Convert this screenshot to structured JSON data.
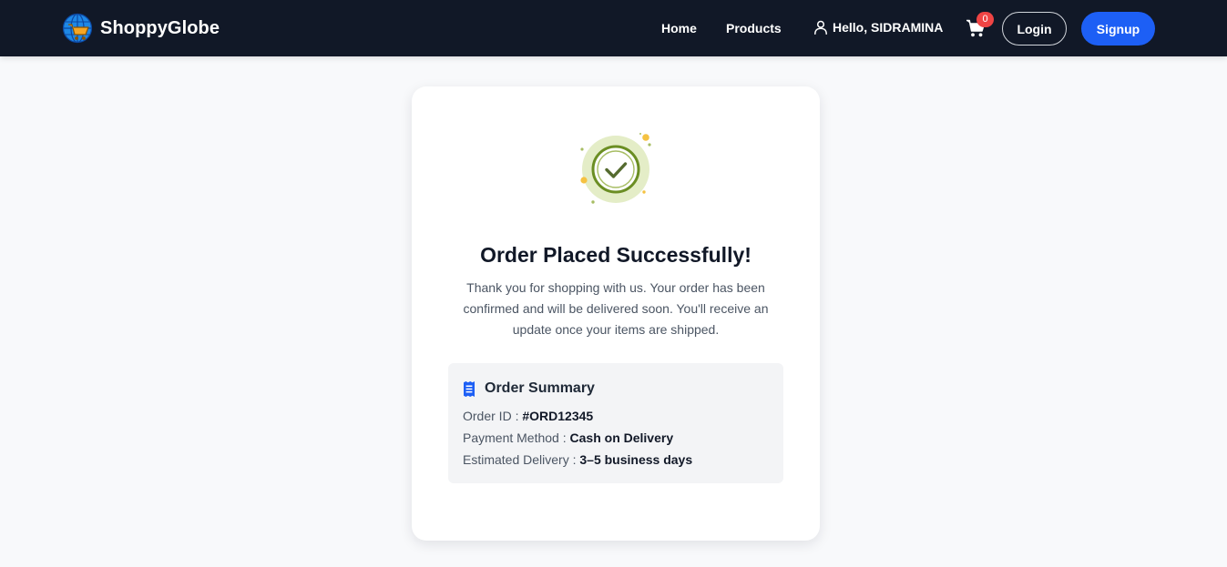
{
  "navbar": {
    "brand": "ShoppyGlobe",
    "links": {
      "home": "Home",
      "products": "Products"
    },
    "greeting": "Hello, SIDRAMINA",
    "cart_count": "0",
    "login_label": "Login",
    "signup_label": "Signup"
  },
  "confirmation": {
    "title": "Order Placed Successfully!",
    "message": "Thank you for shopping with us. Your order has been confirmed and will be delivered soon. You'll receive an update once your items are shipped."
  },
  "summary": {
    "title": "Order Summary",
    "rows": [
      {
        "label": "Order ID :",
        "value": "#ORD12345"
      },
      {
        "label": "Payment Method :",
        "value": "Cash on Delivery"
      },
      {
        "label": "Estimated Delivery :",
        "value": "3–5 business days"
      }
    ]
  },
  "colors": {
    "navbar_bg": "#111827",
    "primary_blue": "#1d5ff5",
    "badge_red": "#ef4444",
    "success_green": "#6b8e23",
    "success_light": "#e4edc7",
    "confetti_yellow": "#f5c242",
    "page_bg": "#f8f9fb"
  },
  "icons": {
    "logo": "globe-cart-icon",
    "user": "user-icon",
    "cart": "shopping-cart-icon",
    "success": "check-circle-icon",
    "summary": "receipt-icon"
  }
}
